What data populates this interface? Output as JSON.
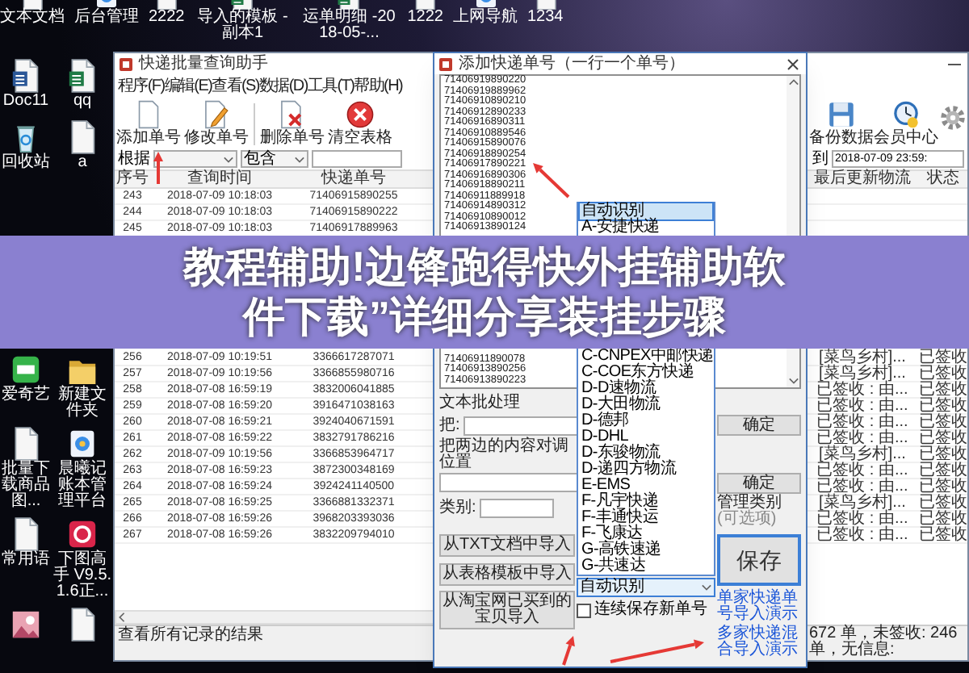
{
  "desktop": {
    "top_icons": [
      {
        "label": "文本文档",
        "kind": "doc"
      },
      {
        "label": "后台管理",
        "kind": "app"
      },
      {
        "label": "2222",
        "kind": "doc"
      },
      {
        "label": "导入的模板 - 副本1",
        "kind": "excel"
      },
      {
        "label": "运单明细 -2018-05-...",
        "kind": "excel"
      },
      {
        "label": "1222",
        "kind": "doc"
      },
      {
        "label": "上网导航",
        "kind": "app"
      },
      {
        "label": "1234",
        "kind": "doc"
      }
    ],
    "left_icons_above_banner": [
      {
        "label": "Doc11",
        "kind": "word"
      },
      {
        "label": "qq",
        "kind": "excel"
      },
      {
        "label": "回收站",
        "kind": "recycle"
      },
      {
        "label": "a",
        "kind": "doc"
      }
    ],
    "left_icons_below_banner": [
      {
        "label": "爱奇艺",
        "kind": "video"
      },
      {
        "label": "新建文件夹",
        "kind": "folder"
      },
      {
        "label": "批量下载商品图...",
        "kind": "doc"
      },
      {
        "label": "晨曦记账本管理平台",
        "kind": "app"
      },
      {
        "label": "常用语",
        "kind": "doc"
      },
      {
        "label": "下图高手 V9.5.1.6正...",
        "kind": "planner"
      },
      {
        "kind": "image"
      },
      {
        "kind": "doc"
      }
    ]
  },
  "main_window": {
    "title": "快递批量查询助手",
    "menu": [
      "程序(F)",
      "编辑(E)",
      "查看(S)",
      "数据(D)",
      "工具(T)",
      "帮助(H)"
    ],
    "toolbar_left": [
      {
        "label": "添加单号",
        "kind": "add"
      },
      {
        "label": "修改单号",
        "kind": "edit"
      },
      {
        "label": "删除单号",
        "kind": "delete"
      },
      {
        "label": "清空表格",
        "kind": "clear"
      }
    ],
    "toolbar_right": [
      {
        "label": "备份数据",
        "kind": "backup"
      },
      {
        "label": "会员中心",
        "kind": "member"
      },
      {
        "kind": "settings"
      }
    ],
    "filter": {
      "field_label": "根据",
      "match_value": "包含",
      "range_separator": "到",
      "end_time": "2018-07-09 23:59:"
    },
    "table": {
      "columns": [
        "序号",
        "查询时间",
        "快递单号",
        "最后更新物流",
        "状态"
      ],
      "rows_above_banner": [
        [
          "243",
          "2018-07-09 10:18:03",
          "71406915890255"
        ],
        [
          "244",
          "2018-07-09 10:18:03",
          "71406915890222"
        ],
        [
          "245",
          "2018-07-09 10:18:03",
          "71406917889963"
        ]
      ],
      "rows_below_banner": [
        [
          "256",
          "2018-07-09 10:19:51",
          "3366617287071",
          "[菜鸟乡村]...",
          "已签收"
        ],
        [
          "257",
          "2018-07-09 10:19:56",
          "3366855980716",
          "[菜鸟乡村]...",
          "已签收"
        ],
        [
          "258",
          "2018-07-08 16:59:19",
          "3832006041885",
          "已签收 : 由...",
          "已签收"
        ],
        [
          "259",
          "2018-07-08 16:59:20",
          "3916471038163",
          "已签收 : 由...",
          "已签收"
        ],
        [
          "260",
          "2018-07-08 16:59:21",
          "3924040671591",
          "已签收 : 由...",
          "已签收"
        ],
        [
          "261",
          "2018-07-08 16:59:22",
          "3832791786216",
          "已签收 : 由...",
          "已签收"
        ],
        [
          "262",
          "2018-07-09 10:19:56",
          "3366853964717",
          "[菜鸟乡村]...",
          "已签收"
        ],
        [
          "263",
          "2018-07-08 16:59:23",
          "3872300348169",
          "已签收 : 由...",
          "已签收"
        ],
        [
          "264",
          "2018-07-08 16:59:24",
          "3924241140500",
          "已签收 : 由...",
          "已签收"
        ],
        [
          "265",
          "2018-07-08 16:59:25",
          "3366881332371",
          "[菜鸟乡村]...",
          "已签收"
        ],
        [
          "266",
          "2018-07-08 16:59:26",
          "3968203393036",
          "已签收 : 由...",
          "已签收"
        ],
        [
          "267",
          "2018-07-08 16:59:26",
          "3832209794010",
          "已签收 : 由...",
          "已签收"
        ]
      ]
    },
    "status_left": "查看所有记录的结果",
    "status_right": "672 单，未签收: 246 单，无信息:"
  },
  "dialog": {
    "title": "添加快递单号（一行一个单号）",
    "numbers_above_banner": [
      "71406919890220",
      "71406919889962",
      "71406910890210",
      "71406912890233",
      "71406916890311",
      "71406910889546",
      "71406915890076",
      "71406918890254",
      "71406917890221",
      "71406916890306",
      "71406918890211",
      "71406911889918",
      "71406914890312",
      "71406910890012",
      "71406913890124"
    ],
    "numbers_below_banner": [
      "71406911890078",
      "71406913890256",
      "71406913890223"
    ],
    "courier_list": {
      "items_above_banner": [
        {
          "label": "自动识别",
          "selected": true
        },
        {
          "label": "A-安捷快递",
          "selected": false
        }
      ],
      "items_below_banner": [
        {
          "label": "C-CNPEX中邮快递",
          "selected": false
        },
        {
          "label": "C-COE东方快递",
          "selected": false
        },
        {
          "label": "D-D速物流",
          "selected": false
        },
        {
          "label": "D-大田物流",
          "selected": false
        },
        {
          "label": "D-德邦",
          "selected": false
        },
        {
          "label": "D-DHL",
          "selected": false
        },
        {
          "label": "D-东骏物流",
          "selected": false
        },
        {
          "label": "D-递四方物流",
          "selected": false
        },
        {
          "label": "E-EMS",
          "selected": false
        },
        {
          "label": "F-凡宇快递",
          "selected": false
        },
        {
          "label": "F-丰通快运",
          "selected": false
        },
        {
          "label": "F-飞康达",
          "selected": false
        },
        {
          "label": "G-高铁速递",
          "selected": false
        },
        {
          "label": "G-共速达",
          "selected": false
        }
      ],
      "value": "自动识别"
    },
    "batch_label": "文本批处理",
    "replace_label": "把:",
    "confirm_buttons": [
      "确定",
      "确定"
    ],
    "swap_label": "把两边的内容对调位置",
    "category_label": "类别:",
    "manage_category": "管理类别",
    "optional_hint": "(可选项)",
    "import_buttons": [
      "从TXT文档中导入",
      "从表格模板中导入",
      "从淘宝网已买到的宝贝导入"
    ],
    "continuous_save": {
      "label": "连续保存新单号",
      "checked": false
    },
    "save_button": "保存",
    "demo_links": [
      "单家快递单号导入演示",
      "多家快递混合导入演示"
    ]
  },
  "banner": {
    "text": "教程辅助!边锋跑得快外挂辅助软件下载”详细分享装挂步骤"
  }
}
